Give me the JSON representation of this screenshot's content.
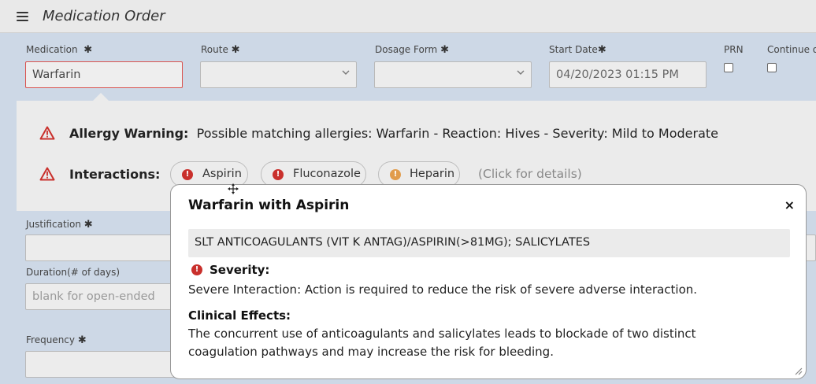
{
  "window": {
    "title": "Medication Order"
  },
  "fields": {
    "medication": {
      "label": "Medication",
      "value": "Warfarin"
    },
    "route": {
      "label": "Route",
      "value": ""
    },
    "dosage_form": {
      "label": "Dosage Form",
      "value": ""
    },
    "start_date": {
      "label": "Start Date",
      "value": "04/20/2023 01:15 PM"
    },
    "prn": {
      "label": "PRN",
      "checked": false
    },
    "continue": {
      "label": "Continue o",
      "checked": false
    },
    "justification": {
      "label": "Justification",
      "value": ""
    },
    "duration": {
      "label": "Duration(# of days)",
      "placeholder": "blank for open-ended"
    },
    "frequency": {
      "label": "Frequency",
      "value": ""
    },
    "required_mark": "✱"
  },
  "allergy_warning": {
    "label": "Allergy Warning:",
    "text": "Possible matching allergies:  Warfarin - Reaction: Hives - Severity: Mild to Moderate"
  },
  "interactions": {
    "label": "Interactions:",
    "items": [
      {
        "name": "Aspirin",
        "severity_color": "#c9302c"
      },
      {
        "name": "Fluconazole",
        "severity_color": "#c9302c"
      },
      {
        "name": "Heparin",
        "severity_color": "#e19c4c"
      }
    ],
    "details_hint": "(Click for details)"
  },
  "popup": {
    "title": "Warfarin with Aspirin",
    "close": "×",
    "code": "SLT ANTICOAGULANTS (VIT K ANTAG)/ASPIRIN(>81MG); SALICYLATES",
    "severity_heading": "Severity:",
    "severity_text": "Severe Interaction: Action is required to reduce the risk of severe adverse interaction.",
    "effects_heading": "Clinical Effects:",
    "effects_text": "The concurrent use of anticoagulants and salicylates leads to blockade of two distinct coagulation pathways and may increase the risk for bleeding."
  },
  "colors": {
    "accent_red": "#c9302c",
    "warning_orange": "#e19c4c",
    "background": "#cdd8e6"
  }
}
